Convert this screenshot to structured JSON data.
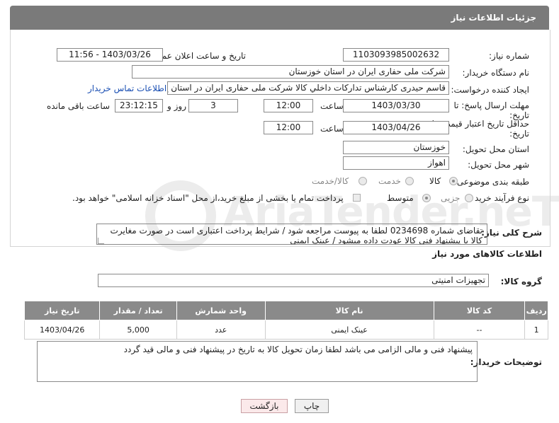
{
  "header": {
    "title": "جزئیات اطلاعات نیاز"
  },
  "fields": {
    "need_number": {
      "label": "شماره نیاز:",
      "value": "1103093985002632"
    },
    "announce_datetime": {
      "label": "تاریخ و ساعت اعلان عمومی:",
      "value": "1403/03/26 - 11:56"
    },
    "buyer_org": {
      "label": "نام دستگاه خریدار:",
      "value": "شرکت ملی حفاری ایران در استان خوزستان"
    },
    "requester": {
      "label": "ایجاد کننده درخواست:",
      "value": "قاسم حیدری کارشناس تداركات داخلي كالا شرکت ملی حفاری ایران در استان خ",
      "link": "اطلاعات تماس خریدار"
    },
    "response_deadline": {
      "label_line1": "مهلت ارسال پاسخ: تا",
      "label_line2": "تاریخ:",
      "date": "1403/03/30",
      "time_label": "ساعت",
      "time": "12:00",
      "days": "3",
      "days_label": "روز و",
      "remaining": "23:12:15",
      "remaining_label": "ساعت باقی مانده"
    },
    "price_validity": {
      "label_line1": "حداقل تاریخ اعتبار قیمت: تا",
      "label_line2": "تاریخ:",
      "date": "1403/04/26",
      "time_label": "ساعت",
      "time": "12:00"
    },
    "delivery_province": {
      "label": "استان محل تحویل:",
      "value": "خوزستان"
    },
    "delivery_city": {
      "label": "شهر محل تحویل:",
      "value": "اهواز"
    },
    "category": {
      "label": "طبقه بندی موضوعی:",
      "options": [
        "کالا",
        "خدمت",
        "کالا/خدمت"
      ]
    },
    "process_type": {
      "label": "نوع فرآیند خرید :",
      "options": [
        "جزیی",
        "متوسط"
      ],
      "payment_note": "پرداخت تمام یا بخشی از مبلغ خرید،از محل \"اسناد خزانه اسلامی\" خواهد بود."
    },
    "description": {
      "label": "شرح کلی نیاز:",
      "value": "تقاضای شماره 0234698 لطفا به پیوست مراجعه شود / شرایط پرداخت اعتباری است در صورت مغایرت کالا یا پیشنهاد فنی کالا عودت داده میشود / عینک ایمنی"
    }
  },
  "goods_section": {
    "title": "اطلاعات کالاهای مورد نیاز",
    "group_label": "گروه کالا:",
    "group_value": "تجهیزات امنیتی"
  },
  "table": {
    "headers": [
      "ردیف",
      "کد کالا",
      "نام کالا",
      "واحد شمارش",
      "تعداد / مقدار",
      "تاریخ نیاز"
    ],
    "rows": [
      [
        "1",
        "--",
        "عینک ایمنی",
        "عدد",
        "5,000",
        "1403/04/26"
      ]
    ]
  },
  "buyer_notes": {
    "label": "توضیحات خریدار:",
    "value": "پیشنهاد فنی و مالی الزامی می باشد لطفا زمان تحویل کالا به تاریخ در پیشنهاد فنی و مالی قید گردد"
  },
  "buttons": {
    "print": "چاپ",
    "back": "بازگشت"
  },
  "watermark": "AriaTender.neT"
}
